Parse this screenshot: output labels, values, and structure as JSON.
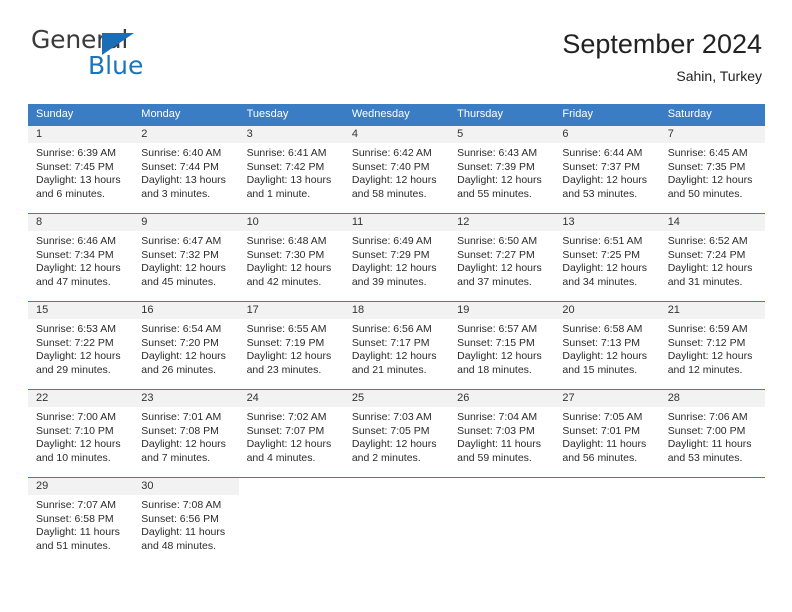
{
  "brand": {
    "name_part1": "General",
    "name_part2": "Blue",
    "logo_icon": "blue-triangle-icon"
  },
  "header": {
    "title": "September 2024",
    "location": "Sahin, Turkey"
  },
  "colors": {
    "header_blue": "#3b7dc4",
    "logo_blue": "#1b75bb",
    "daynum_band": "#f2f2f2",
    "text": "#222222"
  },
  "calendar": {
    "weekdays": [
      "Sunday",
      "Monday",
      "Tuesday",
      "Wednesday",
      "Thursday",
      "Friday",
      "Saturday"
    ],
    "weeks": [
      [
        {
          "day": "1",
          "sunrise": "Sunrise: 6:39 AM",
          "sunset": "Sunset: 7:45 PM",
          "daylight_line1": "Daylight: 13 hours",
          "daylight_line2": "and 6 minutes."
        },
        {
          "day": "2",
          "sunrise": "Sunrise: 6:40 AM",
          "sunset": "Sunset: 7:44 PM",
          "daylight_line1": "Daylight: 13 hours",
          "daylight_line2": "and 3 minutes."
        },
        {
          "day": "3",
          "sunrise": "Sunrise: 6:41 AM",
          "sunset": "Sunset: 7:42 PM",
          "daylight_line1": "Daylight: 13 hours",
          "daylight_line2": "and 1 minute."
        },
        {
          "day": "4",
          "sunrise": "Sunrise: 6:42 AM",
          "sunset": "Sunset: 7:40 PM",
          "daylight_line1": "Daylight: 12 hours",
          "daylight_line2": "and 58 minutes."
        },
        {
          "day": "5",
          "sunrise": "Sunrise: 6:43 AM",
          "sunset": "Sunset: 7:39 PM",
          "daylight_line1": "Daylight: 12 hours",
          "daylight_line2": "and 55 minutes."
        },
        {
          "day": "6",
          "sunrise": "Sunrise: 6:44 AM",
          "sunset": "Sunset: 7:37 PM",
          "daylight_line1": "Daylight: 12 hours",
          "daylight_line2": "and 53 minutes."
        },
        {
          "day": "7",
          "sunrise": "Sunrise: 6:45 AM",
          "sunset": "Sunset: 7:35 PM",
          "daylight_line1": "Daylight: 12 hours",
          "daylight_line2": "and 50 minutes."
        }
      ],
      [
        {
          "day": "8",
          "sunrise": "Sunrise: 6:46 AM",
          "sunset": "Sunset: 7:34 PM",
          "daylight_line1": "Daylight: 12 hours",
          "daylight_line2": "and 47 minutes."
        },
        {
          "day": "9",
          "sunrise": "Sunrise: 6:47 AM",
          "sunset": "Sunset: 7:32 PM",
          "daylight_line1": "Daylight: 12 hours",
          "daylight_line2": "and 45 minutes."
        },
        {
          "day": "10",
          "sunrise": "Sunrise: 6:48 AM",
          "sunset": "Sunset: 7:30 PM",
          "daylight_line1": "Daylight: 12 hours",
          "daylight_line2": "and 42 minutes."
        },
        {
          "day": "11",
          "sunrise": "Sunrise: 6:49 AM",
          "sunset": "Sunset: 7:29 PM",
          "daylight_line1": "Daylight: 12 hours",
          "daylight_line2": "and 39 minutes."
        },
        {
          "day": "12",
          "sunrise": "Sunrise: 6:50 AM",
          "sunset": "Sunset: 7:27 PM",
          "daylight_line1": "Daylight: 12 hours",
          "daylight_line2": "and 37 minutes."
        },
        {
          "day": "13",
          "sunrise": "Sunrise: 6:51 AM",
          "sunset": "Sunset: 7:25 PM",
          "daylight_line1": "Daylight: 12 hours",
          "daylight_line2": "and 34 minutes."
        },
        {
          "day": "14",
          "sunrise": "Sunrise: 6:52 AM",
          "sunset": "Sunset: 7:24 PM",
          "daylight_line1": "Daylight: 12 hours",
          "daylight_line2": "and 31 minutes."
        }
      ],
      [
        {
          "day": "15",
          "sunrise": "Sunrise: 6:53 AM",
          "sunset": "Sunset: 7:22 PM",
          "daylight_line1": "Daylight: 12 hours",
          "daylight_line2": "and 29 minutes."
        },
        {
          "day": "16",
          "sunrise": "Sunrise: 6:54 AM",
          "sunset": "Sunset: 7:20 PM",
          "daylight_line1": "Daylight: 12 hours",
          "daylight_line2": "and 26 minutes."
        },
        {
          "day": "17",
          "sunrise": "Sunrise: 6:55 AM",
          "sunset": "Sunset: 7:19 PM",
          "daylight_line1": "Daylight: 12 hours",
          "daylight_line2": "and 23 minutes."
        },
        {
          "day": "18",
          "sunrise": "Sunrise: 6:56 AM",
          "sunset": "Sunset: 7:17 PM",
          "daylight_line1": "Daylight: 12 hours",
          "daylight_line2": "and 21 minutes."
        },
        {
          "day": "19",
          "sunrise": "Sunrise: 6:57 AM",
          "sunset": "Sunset: 7:15 PM",
          "daylight_line1": "Daylight: 12 hours",
          "daylight_line2": "and 18 minutes."
        },
        {
          "day": "20",
          "sunrise": "Sunrise: 6:58 AM",
          "sunset": "Sunset: 7:13 PM",
          "daylight_line1": "Daylight: 12 hours",
          "daylight_line2": "and 15 minutes."
        },
        {
          "day": "21",
          "sunrise": "Sunrise: 6:59 AM",
          "sunset": "Sunset: 7:12 PM",
          "daylight_line1": "Daylight: 12 hours",
          "daylight_line2": "and 12 minutes."
        }
      ],
      [
        {
          "day": "22",
          "sunrise": "Sunrise: 7:00 AM",
          "sunset": "Sunset: 7:10 PM",
          "daylight_line1": "Daylight: 12 hours",
          "daylight_line2": "and 10 minutes."
        },
        {
          "day": "23",
          "sunrise": "Sunrise: 7:01 AM",
          "sunset": "Sunset: 7:08 PM",
          "daylight_line1": "Daylight: 12 hours",
          "daylight_line2": "and 7 minutes."
        },
        {
          "day": "24",
          "sunrise": "Sunrise: 7:02 AM",
          "sunset": "Sunset: 7:07 PM",
          "daylight_line1": "Daylight: 12 hours",
          "daylight_line2": "and 4 minutes."
        },
        {
          "day": "25",
          "sunrise": "Sunrise: 7:03 AM",
          "sunset": "Sunset: 7:05 PM",
          "daylight_line1": "Daylight: 12 hours",
          "daylight_line2": "and 2 minutes."
        },
        {
          "day": "26",
          "sunrise": "Sunrise: 7:04 AM",
          "sunset": "Sunset: 7:03 PM",
          "daylight_line1": "Daylight: 11 hours",
          "daylight_line2": "and 59 minutes."
        },
        {
          "day": "27",
          "sunrise": "Sunrise: 7:05 AM",
          "sunset": "Sunset: 7:01 PM",
          "daylight_line1": "Daylight: 11 hours",
          "daylight_line2": "and 56 minutes."
        },
        {
          "day": "28",
          "sunrise": "Sunrise: 7:06 AM",
          "sunset": "Sunset: 7:00 PM",
          "daylight_line1": "Daylight: 11 hours",
          "daylight_line2": "and 53 minutes."
        }
      ],
      [
        {
          "day": "29",
          "sunrise": "Sunrise: 7:07 AM",
          "sunset": "Sunset: 6:58 PM",
          "daylight_line1": "Daylight: 11 hours",
          "daylight_line2": "and 51 minutes."
        },
        {
          "day": "30",
          "sunrise": "Sunrise: 7:08 AM",
          "sunset": "Sunset: 6:56 PM",
          "daylight_line1": "Daylight: 11 hours",
          "daylight_line2": "and 48 minutes."
        },
        {
          "day": "",
          "sunrise": "",
          "sunset": "",
          "daylight_line1": "",
          "daylight_line2": ""
        },
        {
          "day": "",
          "sunrise": "",
          "sunset": "",
          "daylight_line1": "",
          "daylight_line2": ""
        },
        {
          "day": "",
          "sunrise": "",
          "sunset": "",
          "daylight_line1": "",
          "daylight_line2": ""
        },
        {
          "day": "",
          "sunrise": "",
          "sunset": "",
          "daylight_line1": "",
          "daylight_line2": ""
        },
        {
          "day": "",
          "sunrise": "",
          "sunset": "",
          "daylight_line1": "",
          "daylight_line2": ""
        }
      ]
    ]
  }
}
